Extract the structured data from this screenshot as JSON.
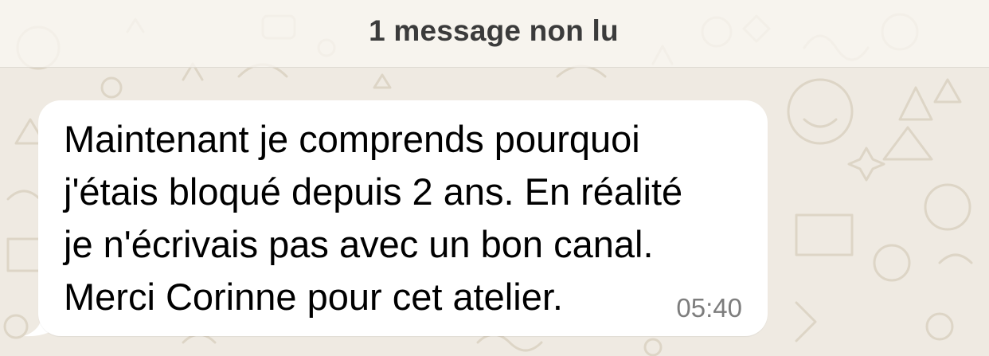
{
  "unread_banner": {
    "label": "1 message non lu"
  },
  "message": {
    "text": "Maintenant je comprends pourquoi\nj'étais bloqué depuis 2 ans. En réalité\nje n'écrivais pas avec un bon canal.\nMerci Corinne pour cet atelier.",
    "time": "05:40",
    "direction": "incoming"
  },
  "colors": {
    "wallpaper": "#efeae2",
    "doodle": "#ddd5c6",
    "bubble": "#ffffff",
    "banner_text": "#3b3b3b",
    "timestamp": "#7d7d7d"
  },
  "icons": {
    "wallpaper": "chat-doodle-pattern"
  }
}
